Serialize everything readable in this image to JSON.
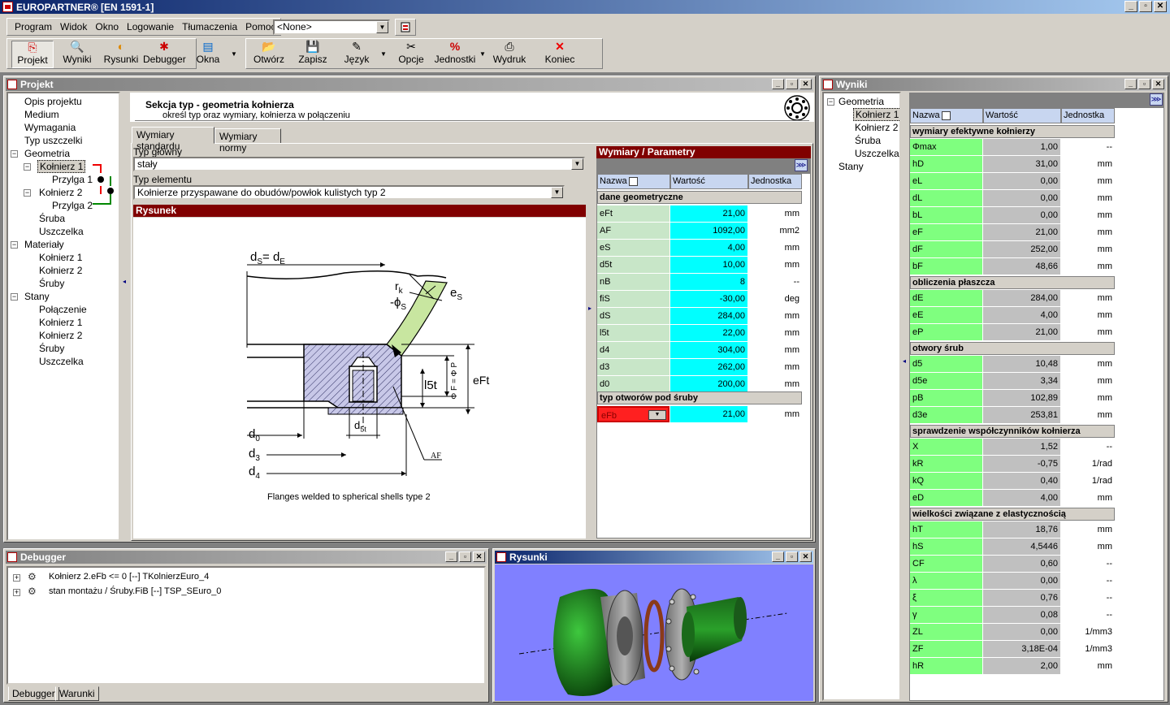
{
  "app": {
    "title": "EUROPARTNER® [EN 1591-1]",
    "min": "_",
    "max": "▫",
    "close": "✕"
  },
  "menu": [
    "Program",
    "Widok",
    "Okno",
    "Logowanie",
    "Tłumaczenia",
    "Pomoc"
  ],
  "combo_value": "<None>",
  "toolbar": [
    {
      "label": "Projekt",
      "icon": "project-icon",
      "glyph": "⎘"
    },
    {
      "label": "Wyniki",
      "icon": "results-icon",
      "glyph": "🔍"
    },
    {
      "label": "Rysunki",
      "icon": "drawings-icon",
      "glyph": "◐"
    },
    {
      "label": "Debugger",
      "icon": "debugger-icon",
      "glyph": "✱"
    },
    {
      "label": "Okna",
      "icon": "windows-icon",
      "glyph": "▤"
    },
    {
      "label": "Otwórz",
      "icon": "open-icon",
      "glyph": "📂"
    },
    {
      "label": "Zapisz",
      "icon": "save-icon",
      "glyph": "💾"
    },
    {
      "label": "Język",
      "icon": "language-icon",
      "glyph": "✎"
    },
    {
      "label": "Opcje",
      "icon": "options-icon",
      "glyph": "✂"
    },
    {
      "label": "Jednostki",
      "icon": "units-icon",
      "glyph": "%"
    },
    {
      "label": "Wydruk",
      "icon": "print-icon",
      "glyph": "⎙"
    },
    {
      "label": "Koniec",
      "icon": "exit-icon",
      "glyph": "✕"
    }
  ],
  "projekt": {
    "title": "Projekt",
    "tree": {
      "opis": "Opis projektu",
      "medium": "Medium",
      "wymagania": "Wymagania",
      "typ_uszczelki": "Typ uszczelki",
      "geometria": "Geometria",
      "kolnierz1": "Kołnierz 1",
      "przylga1": "Przylga 1",
      "kolnierz2": "Kołnierz 2",
      "przylga2": "Przylga 2",
      "sruba": "Śruba",
      "uszczelka": "Uszczelka",
      "materialy": "Materiały",
      "m_kolnierz1": "Kołnierz 1",
      "m_kolnierz2": "Kołnierz 2",
      "m_sruby": "Śruby",
      "stany": "Stany",
      "polaczenie": "Połączenie",
      "s_kolnierz1": "Kołnierz 1",
      "s_kolnierz2": "Kołnierz 2",
      "s_sruby": "Śruby",
      "s_uszczelka": "Uszczelka"
    },
    "section_title": "Sekcja typ - geometria kołnierza",
    "section_sub": "określ typ oraz wymiary, kołnierza w połączeniu",
    "tabs": [
      "Wymiary standardu",
      "Wymiary normy"
    ],
    "typ_glowny_label": "Typ główny",
    "typ_glowny_value": "stały",
    "typ_elementu_label": "Typ elementu",
    "typ_elementu_value": "Kołnierze przyspawane do obudów/powłok kulistych typ 2",
    "rysunek": "Rysunek",
    "drawing": {
      "ds": "d",
      "ds_sub": "S",
      "de_eq": "= d",
      "de_sub": "E",
      "rk": "r",
      "rk_sub": "k",
      "phis": "-ϕ",
      "phis_sub": "S",
      "es": "e",
      "es_sub": "S",
      "l5t": "l5t",
      "eft": "eFt",
      "phif": "Φ F = Φ P",
      "d0": "d",
      "d0_sub": "0",
      "d3": "d",
      "d3_sub": "3",
      "d4": "d",
      "d4_sub": "4",
      "d5t": "d",
      "d5t_sub": "5t",
      "af": "AF",
      "caption": "Flanges welded to spherical shells type  2"
    }
  },
  "wymiary": {
    "title": "Wymiary / Parametry",
    "headers": [
      "Nazwa",
      "Wartość",
      "Jednostka"
    ],
    "section1": "dane geometryczne",
    "rows": [
      [
        "eFt",
        "21,00",
        "mm"
      ],
      [
        "AF",
        "1092,00",
        "mm2"
      ],
      [
        "eS",
        "4,00",
        "mm"
      ],
      [
        "d5t",
        "10,00",
        "mm"
      ],
      [
        "nB",
        "8",
        "--"
      ],
      [
        "fiS",
        "-30,00",
        "deg"
      ],
      [
        "dS",
        "284,00",
        "mm"
      ],
      [
        "l5t",
        "22,00",
        "mm"
      ],
      [
        "d4",
        "304,00",
        "mm"
      ],
      [
        "d3",
        "262,00",
        "mm"
      ],
      [
        "d0",
        "200,00",
        "mm"
      ]
    ],
    "section2": "typ otworów pod śruby",
    "efb": [
      "eFb",
      "21,00",
      "mm"
    ]
  },
  "wyniki": {
    "title": "Wyniki",
    "tree": {
      "geometria": "Geometria",
      "k1": "Kołnierz 1",
      "k2": "Kołnierz 2",
      "sruba": "Śruba",
      "uszczelka": "Uszczelka",
      "stany": "Stany"
    },
    "headers": [
      "Nazwa",
      "Wartość",
      "Jednostka"
    ],
    "groups": [
      {
        "title": "wymiary efektywne kołnierzy",
        "rows": [
          [
            "Φmax",
            "1,00",
            "--"
          ],
          [
            "hD",
            "31,00",
            "mm"
          ],
          [
            "eL",
            "0,00",
            "mm"
          ],
          [
            "dL",
            "0,00",
            "mm"
          ],
          [
            "bL",
            "0,00",
            "mm"
          ],
          [
            "eF",
            "21,00",
            "mm"
          ],
          [
            "dF",
            "252,00",
            "mm"
          ],
          [
            "bF",
            "48,66",
            "mm"
          ]
        ]
      },
      {
        "title": "obliczenia płaszcza",
        "rows": [
          [
            "dE",
            "284,00",
            "mm"
          ],
          [
            "eE",
            "4,00",
            "mm"
          ],
          [
            "eP",
            "21,00",
            "mm"
          ]
        ]
      },
      {
        "title": "otwory śrub",
        "rows": [
          [
            "d5",
            "10,48",
            "mm"
          ],
          [
            "d5e",
            "3,34",
            "mm"
          ],
          [
            "pB",
            "102,89",
            "mm"
          ],
          [
            "d3e",
            "253,81",
            "mm"
          ]
        ]
      },
      {
        "title": "sprawdzenie współczynników kołnierza",
        "rows": [
          [
            "X",
            "1,52",
            "--"
          ],
          [
            "kR",
            "-0,75",
            "1/rad"
          ],
          [
            "kQ",
            "0,40",
            "1/rad"
          ],
          [
            "eD",
            "4,00",
            "mm"
          ]
        ]
      },
      {
        "title": "wielkości związane z elastycznością",
        "rows": [
          [
            "hT",
            "18,76",
            "mm"
          ],
          [
            "hS",
            "4,5446",
            "mm"
          ],
          [
            "CF",
            "0,60",
            "--"
          ],
          [
            "λ",
            "0,00",
            "--"
          ],
          [
            "ξ",
            "0,76",
            "--"
          ],
          [
            "γ",
            "0,08",
            "--"
          ],
          [
            "ZL",
            "0,00",
            "1/mm3"
          ],
          [
            "ZF",
            "3,18E-04",
            "1/mm3"
          ],
          [
            "hR",
            "2,00",
            "mm"
          ]
        ]
      }
    ]
  },
  "debugger": {
    "title": "Debugger",
    "items": [
      "Kołnierz 2.eFb <= 0 [--] TKolnierzEuro_4",
      "stan montażu / Śruby.FiB [--] TSP_SEuro_0"
    ],
    "tabs": [
      "Debugger",
      "Warunki"
    ]
  },
  "rysunki": {
    "title": "Rysunki",
    "bg": "#8080ff"
  }
}
